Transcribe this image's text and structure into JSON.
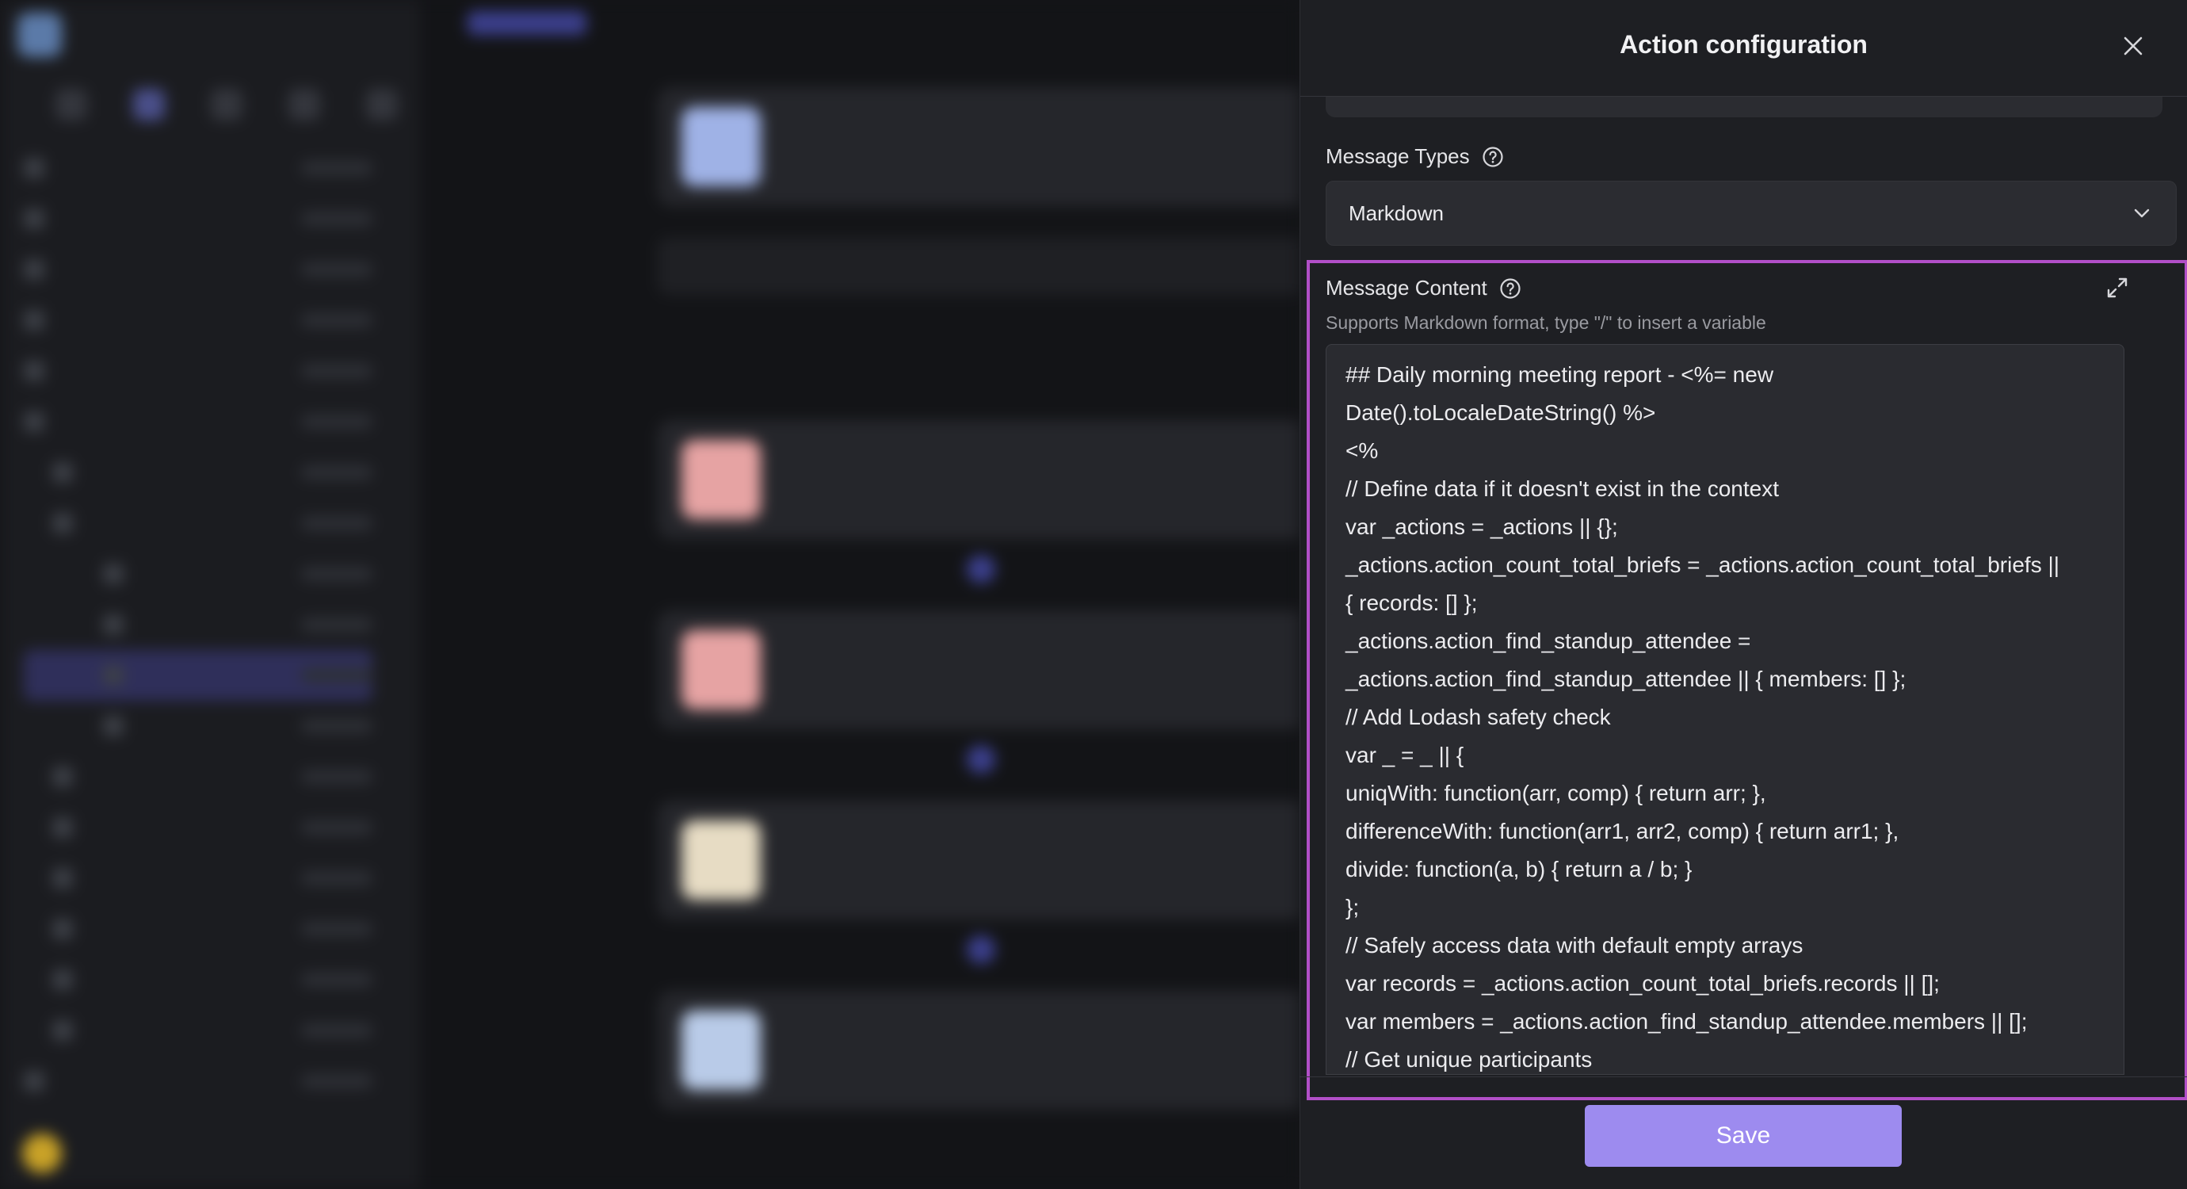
{
  "panel": {
    "title": "Action configuration",
    "message_types": {
      "label": "Message Types",
      "selected": "Markdown"
    },
    "message_content": {
      "label": "Message Content",
      "hint": "Supports Markdown format, type \"/\" to insert a variable",
      "lines": [
        "## Daily morning meeting report - <%= new",
        "Date().toLocaleDateString() %>",
        "<%",
        "// Define data if it doesn't exist in the context",
        "var _actions = _actions || {};",
        "_actions.action_count_total_briefs = _actions.action_count_total_briefs ||",
        "{ records: [] };",
        "_actions.action_find_standup_attendee =",
        "_actions.action_find_standup_attendee || { members: [] };",
        "// Add Lodash safety check",
        "var _ = _ || {",
        "uniqWith: function(arr, comp) { return arr; },",
        "differenceWith: function(arr1, arr2, comp) { return arr1; },",
        "divide: function(a, b) { return a / b; }",
        "};",
        "// Safely access data with default empty arrays",
        "var records = _actions.action_count_total_briefs.records || [];",
        "var members = _actions.action_find_standup_attendee.members || [];",
        "// Get unique participants"
      ]
    },
    "save_label": "Save"
  },
  "icons": {
    "close": "close-icon",
    "help": "question-circle-icon",
    "chevron": "chevron-down-icon",
    "expand": "expand-icon"
  },
  "colors": {
    "highlight_border": "#b24fc8",
    "save_button": "#9d8bef",
    "panel_bg": "#1e1f23",
    "editor_bg": "#2a2b30"
  }
}
